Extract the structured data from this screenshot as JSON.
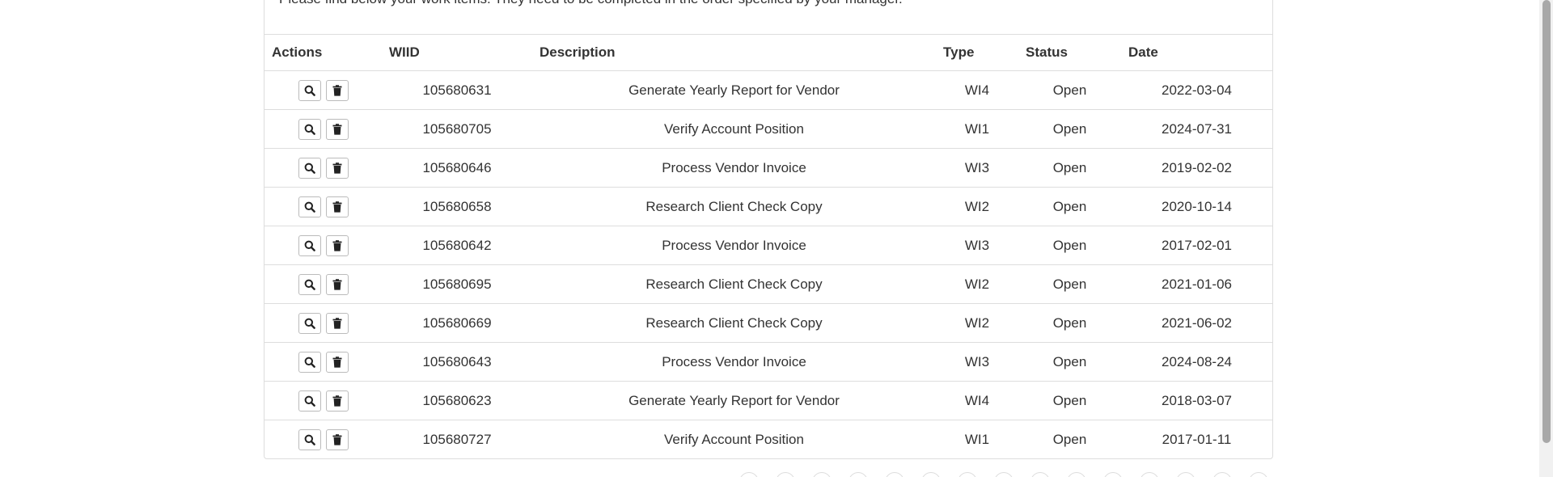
{
  "intro_text": "Please find below your work items. They need to be completed in the order specified by your manager.",
  "table": {
    "headers": {
      "actions": "Actions",
      "wiid": "WIID",
      "description": "Description",
      "type": "Type",
      "status": "Status",
      "date": "Date"
    },
    "rows": [
      {
        "wiid": "105680631",
        "description": "Generate Yearly Report for Vendor",
        "type": "WI4",
        "status": "Open",
        "date": "2022-03-04"
      },
      {
        "wiid": "105680705",
        "description": "Verify Account Position",
        "type": "WI1",
        "status": "Open",
        "date": "2024-07-31"
      },
      {
        "wiid": "105680646",
        "description": "Process Vendor Invoice",
        "type": "WI3",
        "status": "Open",
        "date": "2019-02-02"
      },
      {
        "wiid": "105680658",
        "description": "Research Client Check Copy",
        "type": "WI2",
        "status": "Open",
        "date": "2020-10-14"
      },
      {
        "wiid": "105680642",
        "description": "Process Vendor Invoice",
        "type": "WI3",
        "status": "Open",
        "date": "2017-02-01"
      },
      {
        "wiid": "105680695",
        "description": "Research Client Check Copy",
        "type": "WI2",
        "status": "Open",
        "date": "2021-01-06"
      },
      {
        "wiid": "105680669",
        "description": "Research Client Check Copy",
        "type": "WI2",
        "status": "Open",
        "date": "2021-06-02"
      },
      {
        "wiid": "105680643",
        "description": "Process Vendor Invoice",
        "type": "WI3",
        "status": "Open",
        "date": "2024-08-24"
      },
      {
        "wiid": "105680623",
        "description": "Generate Yearly Report for Vendor",
        "type": "WI4",
        "status": "Open",
        "date": "2018-03-07"
      },
      {
        "wiid": "105680727",
        "description": "Verify Account Position",
        "type": "WI1",
        "status": "Open",
        "date": "2017-01-11"
      }
    ]
  },
  "row_actions": {
    "view_icon": "search-icon",
    "delete_icon": "trash-icon"
  },
  "pagination_dots": 15
}
